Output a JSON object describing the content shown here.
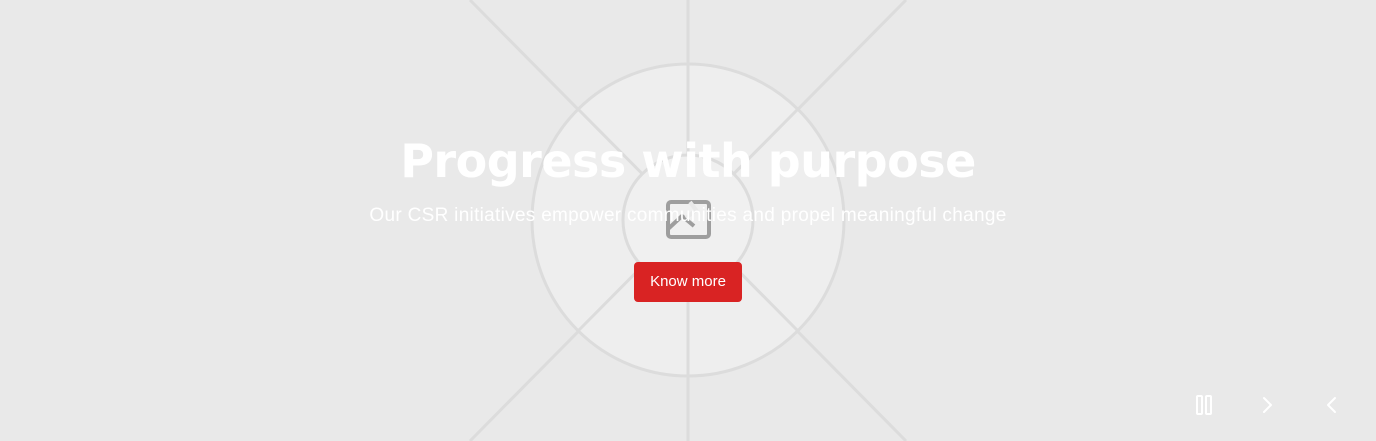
{
  "hero": {
    "headline": "Progress with purpose",
    "subline": "Our CSR initiatives empower communities and propel meaningful change",
    "cta_label": "Know more",
    "placeholder_icon": "broken-image-icon"
  },
  "carousel_controls": {
    "pause_icon": "pause-icon",
    "next_icon": "chevron-right-icon",
    "prev_icon": "chevron-left-icon"
  },
  "colors": {
    "background": "#e9e9e9",
    "cta_background": "#d92323",
    "text": "#ffffff",
    "placeholder_lines": "#d6d6d6"
  }
}
